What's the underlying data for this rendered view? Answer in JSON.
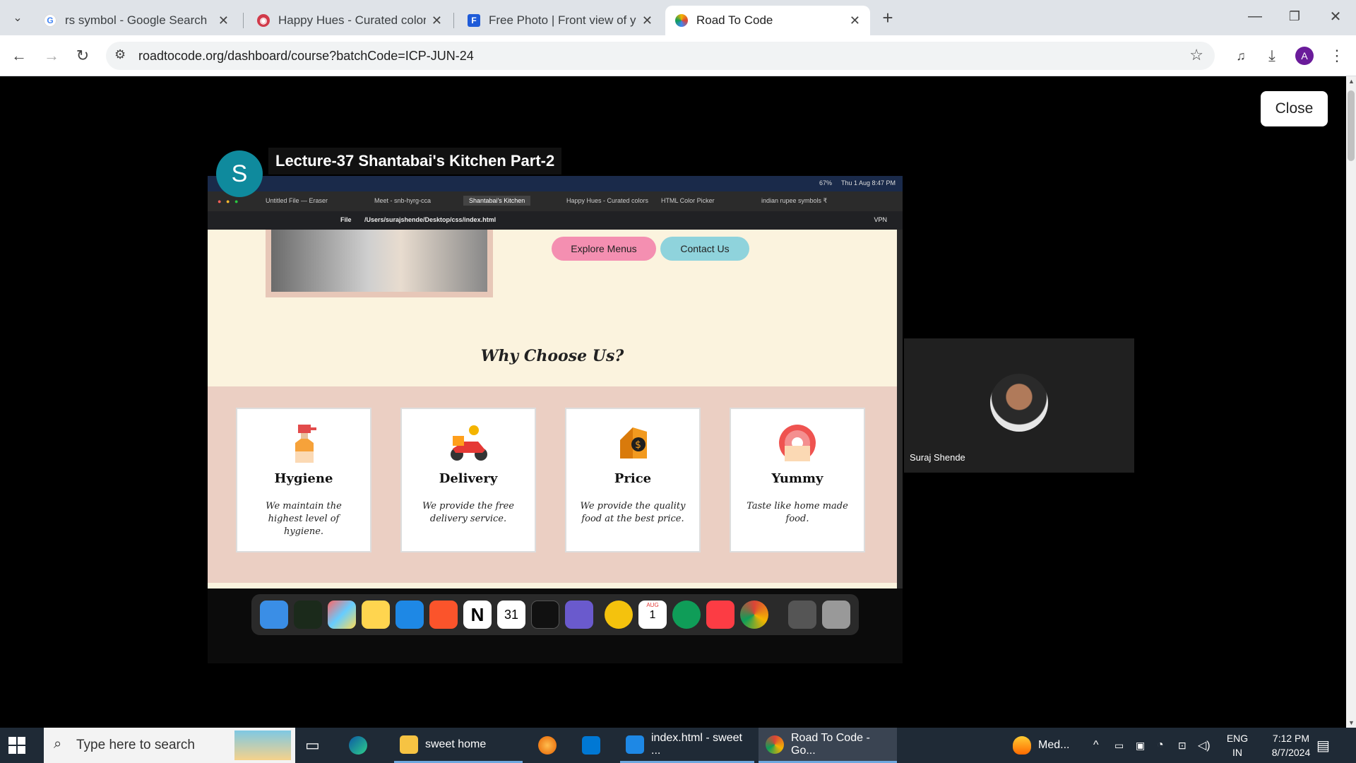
{
  "browser": {
    "tabs": [
      {
        "title": "rs symbol - Google Search",
        "active": false
      },
      {
        "title": "Happy Hues - Curated colors in",
        "active": false
      },
      {
        "title": "Free Photo | Front view of yumm",
        "active": false
      },
      {
        "title": "Road To Code",
        "active": true
      }
    ],
    "url": "roadtocode.org/dashboard/course?batchCode=ICP-JUN-24",
    "profile_initial": "A"
  },
  "player": {
    "close_label": "Close",
    "channel_initial": "S",
    "lecture_title": "Lecture-37 Shantabai's Kitchen Part-2",
    "mac_clock": "Thu 1 Aug  8:47 PM",
    "mac_battery": "67%",
    "mac_tabs": [
      "Untitled File — Eraser",
      "Meet - snb-hyrg-cca",
      "Shantabai's Kitchen",
      "Happy Hues - Curated colors",
      "HTML Color Picker",
      "indian rupee symbols ₹"
    ],
    "mac_address_scheme": "File",
    "mac_address": "/Users/surajshende/Desktop/css/index.html",
    "mac_vpn": "VPN",
    "site": {
      "explore_label": "Explore Menus",
      "contact_label": "Contact Us",
      "why_title": "Why Choose Us?",
      "cards": [
        {
          "title": "Hygiene",
          "desc": "We maintain the highest level of hygiene.",
          "icon": "spray-bottle-icon"
        },
        {
          "title": "Delivery",
          "desc": "We provide the free delivery service.",
          "icon": "delivery-scooter-icon"
        },
        {
          "title": "Price",
          "desc": "We provide the quality food at the best price.",
          "icon": "price-tag-icon"
        },
        {
          "title": "Yummy",
          "desc": "Taste like home made food.",
          "icon": "donut-icon"
        }
      ],
      "accent_pink": "#f48fb1",
      "accent_teal": "#8fd3dc"
    },
    "dock_calendar_month": "AUG",
    "dock_calendar_day": "1",
    "dock_cal_app_day": "31"
  },
  "participant": {
    "name": "Suraj Shende"
  },
  "taskbar": {
    "search_placeholder": "Type here to search",
    "apps": [
      {
        "label": "sweet home"
      },
      {
        "label": "index.html - sweet ..."
      },
      {
        "label": "Road To Code - Go..."
      },
      {
        "label": "Med..."
      }
    ],
    "lang": "ENG",
    "region": "IN",
    "time": "7:12 PM",
    "date": "8/7/2024"
  }
}
